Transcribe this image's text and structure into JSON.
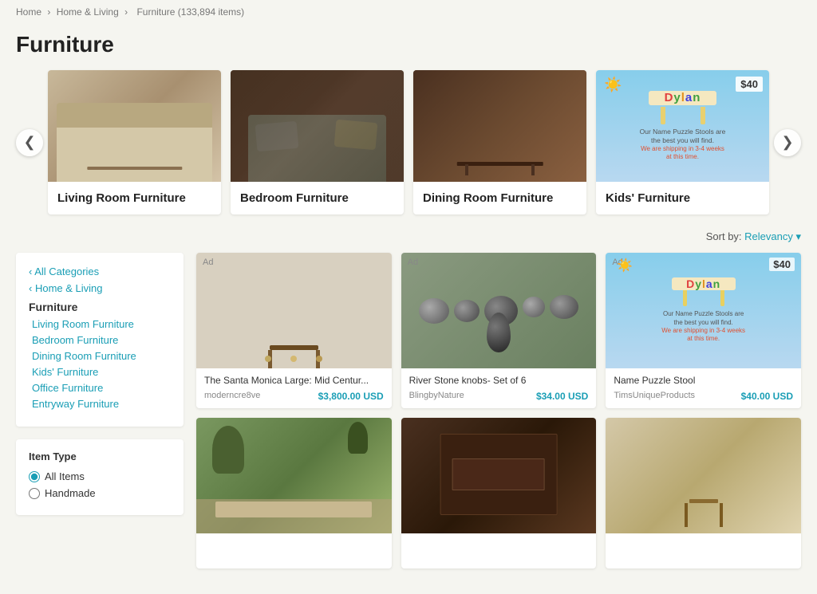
{
  "breadcrumb": {
    "home": "Home",
    "sep1": "›",
    "home_living": "Home & Living",
    "sep2": "›",
    "current": "Furniture (133,894 items)"
  },
  "page": {
    "title": "Furniture"
  },
  "categories": [
    {
      "id": "living",
      "label": "Living Room Furniture",
      "imgClass": "cat-img-living"
    },
    {
      "id": "bedroom",
      "label": "Bedroom Furniture",
      "imgClass": "cat-img-bedroom"
    },
    {
      "id": "dining",
      "label": "Dining Room Furniture",
      "imgClass": "cat-img-dining"
    },
    {
      "id": "kids",
      "label": "Kids' Furniture",
      "imgClass": "cat-img-kids"
    }
  ],
  "sort": {
    "label": "Sort by:",
    "value": "Relevancy"
  },
  "sidebar": {
    "all_categories": "All Categories",
    "home_living": "Home & Living",
    "furniture_title": "Furniture",
    "sub_links": [
      "Living Room Furniture",
      "Bedroom Furniture",
      "Dining Room Furniture",
      "Kids' Furniture",
      "Office Furniture",
      "Entryway Furniture"
    ]
  },
  "filter": {
    "title": "Item Type",
    "options": [
      {
        "label": "All Items",
        "checked": true
      },
      {
        "label": "Handmade",
        "checked": false
      }
    ]
  },
  "products": [
    {
      "ad": true,
      "name": "The Santa Monica Large: Mid Centur...",
      "shop": "moderncre8ve",
      "price": "$3,800.00 USD",
      "imgClass": "prod-img-table1"
    },
    {
      "ad": true,
      "name": "River Stone knobs- Set of 6",
      "shop": "BlingbyNature",
      "price": "$34.00 USD",
      "imgClass": "prod-img-rocks"
    },
    {
      "ad": true,
      "name": "Name Puzzle Stool",
      "shop": "TimsUniqueProducts",
      "price": "$40.00 USD",
      "imgClass": "prod-img-puzzle"
    },
    {
      "ad": false,
      "name": "",
      "shop": "",
      "price": "",
      "imgClass": "prod-img-house"
    },
    {
      "ad": false,
      "name": "",
      "shop": "",
      "price": "",
      "imgClass": "prod-img-wood"
    },
    {
      "ad": false,
      "name": "",
      "shop": "",
      "price": "",
      "imgClass": "prod-img-table2"
    }
  ],
  "nav": {
    "left_arrow": "❮",
    "right_arrow": "❯"
  }
}
